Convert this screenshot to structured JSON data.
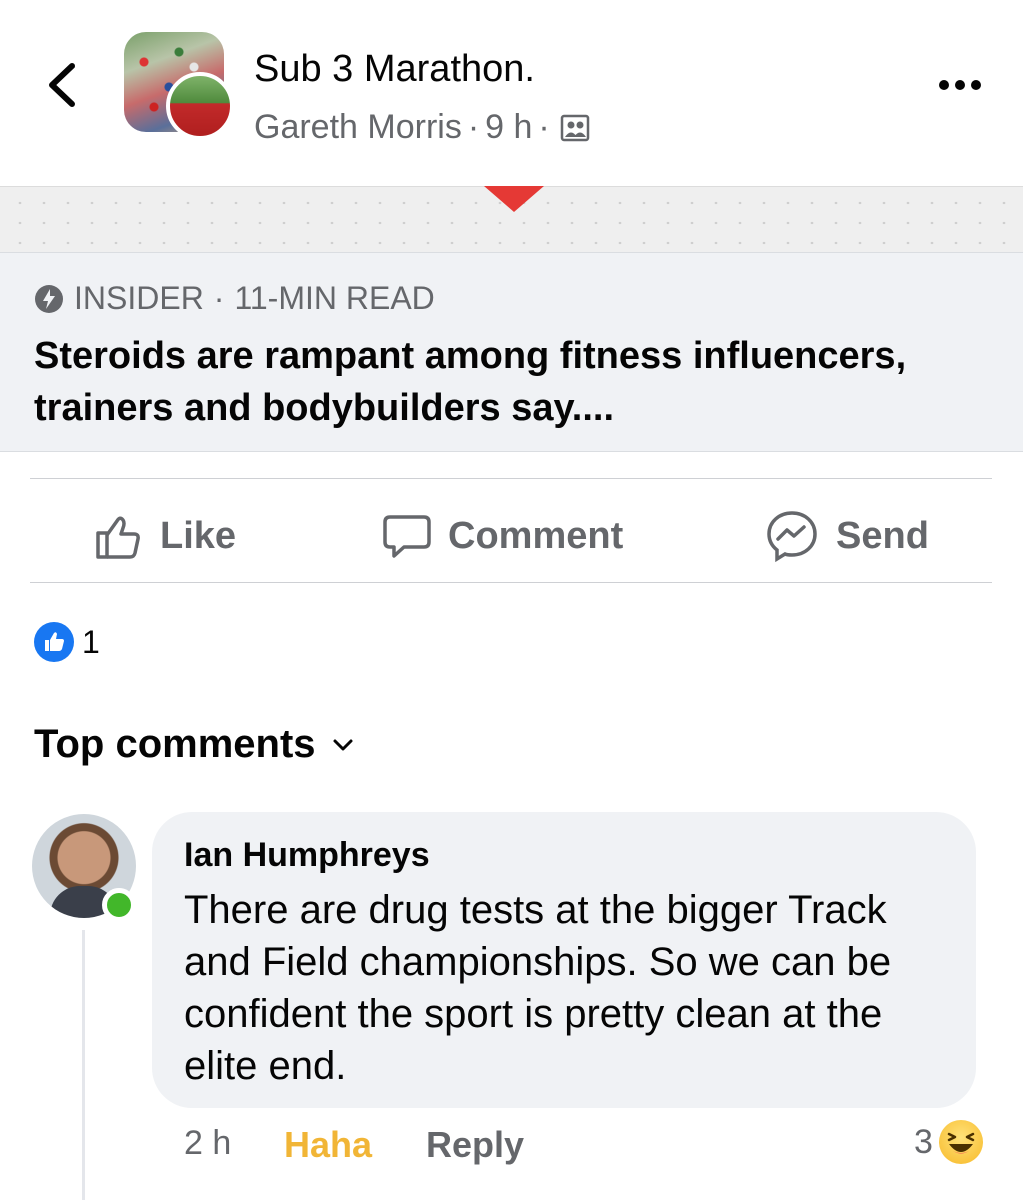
{
  "post": {
    "group_name": "Sub 3 Marathon.",
    "author": "Gareth Morris",
    "separator_1": "·",
    "time": "9 h",
    "separator_2": "·",
    "audience_icon": "group-members-icon"
  },
  "link_preview": {
    "source": "INSIDER",
    "source_separator": "·",
    "read_time": "11-MIN READ",
    "title": "Steroids are rampant among fitness influencers, trainers and bodybuilders say....",
    "marker_color": "#e53935"
  },
  "actions": {
    "like": "Like",
    "comment": "Comment",
    "send": "Send"
  },
  "reactions": {
    "count": "1",
    "type": "like"
  },
  "comments_section": {
    "sort_label": "Top comments"
  },
  "comments": [
    {
      "author": "Ian Humphreys",
      "text": "There are drug tests at the bigger Track and Field championships. So we can be confident the sport is pretty clean at the elite end.",
      "time": "2 h",
      "reaction_label": "Haha",
      "reply_label": "Reply",
      "reaction_count": "3",
      "reaction_type": "haha",
      "online": true
    }
  ],
  "colors": {
    "secondary_text": "#65676b",
    "brand_blue": "#1877f2",
    "haha_yellow": "#f1b536",
    "online_green": "#42b72a"
  }
}
